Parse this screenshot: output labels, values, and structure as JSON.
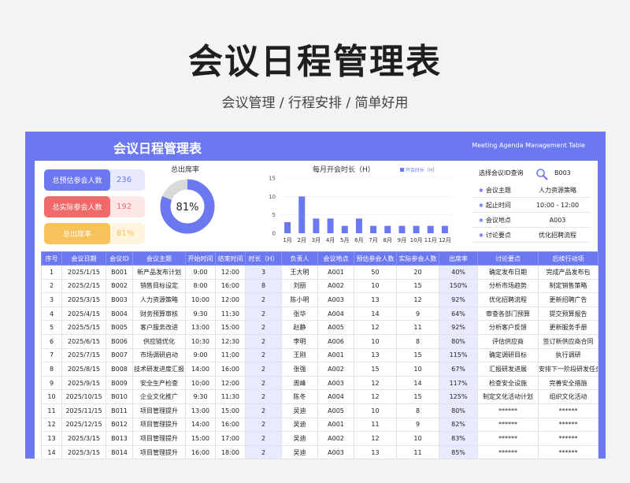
{
  "page": {
    "title": "会议日程管理表",
    "subtitle": "会议管理 /  行程安排 /   简单好用"
  },
  "banner": {
    "title": "会议日程管理表",
    "subtitle": "Meeting Agenda Management Table"
  },
  "stats": [
    {
      "label": "总预估参会人数",
      "value": "236"
    },
    {
      "label": "总实际参会人数",
      "value": "192"
    },
    {
      "label": "总出席率",
      "value": "81%"
    }
  ],
  "colors": {
    "accent": "#6c78f0",
    "red": "#f06a6a",
    "yellow": "#f7c25a",
    "track": "#d9d9d9"
  },
  "chart_data": [
    {
      "type": "pie",
      "title": "总出席率",
      "values": [
        81,
        19
      ],
      "center_label": "81%"
    },
    {
      "type": "bar",
      "title": "每月开会时长（H）",
      "series": [
        {
          "name": "开会时长（H）",
          "values": [
            3,
            10,
            4,
            4,
            2,
            4,
            2,
            2,
            2,
            2,
            2,
            2
          ]
        }
      ],
      "categories": [
        "1月",
        "2月",
        "3月",
        "4月",
        "5月",
        "6月",
        "7月",
        "8月",
        "9月",
        "10月",
        "11月",
        "12月"
      ],
      "yticks": [
        "0",
        "5",
        "10",
        "15"
      ],
      "ylim": [
        0,
        15
      ],
      "legend": "top"
    }
  ],
  "lookup": {
    "query_label": "选择会议ID查询",
    "query_value": "B003",
    "items": [
      {
        "label": "会议主题",
        "value": "人力资源策略"
      },
      {
        "label": "起止时间",
        "value": "10:00 - 12:00"
      },
      {
        "label": "会议地点",
        "value": "A003"
      },
      {
        "label": "讨论要点",
        "value": "优化招聘流程"
      }
    ]
  },
  "table": {
    "headers": [
      "序号",
      "会议日期",
      "会议ID",
      "会议主题",
      "开始时间",
      "结束时间",
      "时长（H）",
      "负责人",
      "会议地点",
      "预估参会人数",
      "实际参会人数",
      "出席率",
      "讨论要点",
      "后续行动项"
    ],
    "rows": [
      [
        "1",
        "2025/1/15",
        "B001",
        "新产品发布计划",
        "9:00",
        "12:00",
        "3",
        "王大明",
        "A001",
        "50",
        "20",
        "40%",
        "确定发布日期",
        "完成产品发布包"
      ],
      [
        "2",
        "2025/2/15",
        "B002",
        "销售目标设定",
        "8:00",
        "16:00",
        "8",
        "刘丽",
        "A002",
        "10",
        "15",
        "150%",
        "分析市场趋势",
        "制定销售策略"
      ],
      [
        "3",
        "2025/3/15",
        "B003",
        "人力资源策略",
        "10:00",
        "12:00",
        "2",
        "陈小明",
        "A003",
        "13",
        "12",
        "92%",
        "优化招聘流程",
        "更新招聘广告"
      ],
      [
        "4",
        "2025/4/15",
        "B004",
        "财务预算审核",
        "9:30",
        "11:30",
        "2",
        "张华",
        "A004",
        "14",
        "9",
        "64%",
        "审查各部门预算",
        "提交预算报告"
      ],
      [
        "5",
        "2025/5/15",
        "B005",
        "客户服务改进",
        "13:00",
        "15:00",
        "2",
        "赵静",
        "A005",
        "12",
        "11",
        "92%",
        "分析客户反馈",
        "更新服务手册"
      ],
      [
        "6",
        "2025/6/15",
        "B006",
        "供应链优化",
        "10:30",
        "12:30",
        "2",
        "李明",
        "A006",
        "10",
        "8",
        "80%",
        "评估供应商",
        "签订新供应商合同"
      ],
      [
        "7",
        "2025/7/15",
        "B007",
        "市场调研启动",
        "9:00",
        "11:00",
        "2",
        "王刚",
        "A001",
        "13",
        "15",
        "115%",
        "确定调研目标",
        "执行调研"
      ],
      [
        "8",
        "2025/8/15",
        "B008",
        "技术研发进度汇报",
        "14:00",
        "16:00",
        "2",
        "张强",
        "A002",
        "15",
        "10",
        "67%",
        "汇报研发进展",
        "安排下一阶段研发任务"
      ],
      [
        "9",
        "2025/9/15",
        "B009",
        "安全生产检查",
        "10:00",
        "12:00",
        "2",
        "周峰",
        "A003",
        "12",
        "14",
        "117%",
        "检查安全设施",
        "完善安全措施"
      ],
      [
        "10",
        "2025/10/15",
        "B010",
        "企业文化推广",
        "9:30",
        "11:30",
        "2",
        "陈冬",
        "A004",
        "12",
        "15",
        "125%",
        "制定文化活动计划",
        "组织文化活动"
      ],
      [
        "11",
        "2025/11/15",
        "B011",
        "项目管理提升",
        "13:00",
        "15:00",
        "2",
        "吴迪",
        "A005",
        "10",
        "8",
        "80%",
        "******",
        "******"
      ],
      [
        "12",
        "2025/12/15",
        "B012",
        "项目管理提升",
        "14:00",
        "16:00",
        "2",
        "吴迪",
        "A001",
        "11",
        "9",
        "82%",
        "******",
        "******"
      ],
      [
        "13",
        "2025/3/15",
        "B013",
        "项目管理提升",
        "15:00",
        "17:00",
        "2",
        "吴迪",
        "A002",
        "12",
        "10",
        "83%",
        "******",
        "******"
      ],
      [
        "14",
        "2025/3/15",
        "B014",
        "项目管理提升",
        "16:00",
        "18:00",
        "2",
        "吴迪",
        "A003",
        "13",
        "11",
        "85%",
        "******",
        "******"
      ]
    ]
  }
}
